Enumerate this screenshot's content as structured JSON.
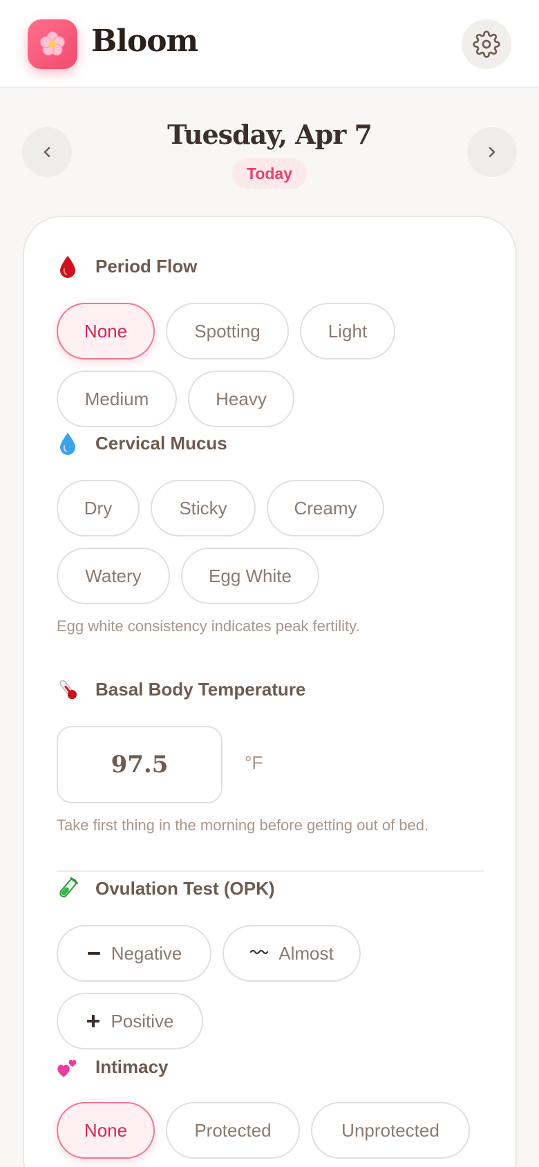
{
  "app": {
    "title": "Bloom",
    "logo_icon": "cherry-blossom-icon",
    "settings_icon": "gear-icon"
  },
  "date_nav": {
    "title": "Tuesday, Apr 7",
    "badge": "Today",
    "prev_icon": "chevron-left-icon",
    "next_icon": "chevron-right-icon"
  },
  "period_flow": {
    "title": "Period Flow",
    "icon": "blood-drop-icon",
    "options": [
      "None",
      "Spotting",
      "Light",
      "Medium",
      "Heavy"
    ],
    "selected": "None"
  },
  "cervical_mucus": {
    "title": "Cervical Mucus",
    "icon": "water-drop-icon",
    "options": [
      "Dry",
      "Sticky",
      "Creamy",
      "Watery",
      "Egg White"
    ],
    "selected": null,
    "hint": "Egg white consistency indicates peak fertility."
  },
  "bbt": {
    "title": "Basal Body Temperature",
    "icon": "thermometer-icon",
    "value": "97.5",
    "unit": "°F",
    "hint": "Take first thing in the morning before getting out of bed."
  },
  "opk": {
    "title": "Ovulation Test (OPK)",
    "icon": "test-tube-icon",
    "options": [
      {
        "label": "Negative",
        "icon": "minus-icon"
      },
      {
        "label": "Almost",
        "icon": "wave-icon"
      },
      {
        "label": "Positive",
        "icon": "plus-icon"
      }
    ],
    "selected": null
  },
  "intimacy": {
    "title": "Intimacy",
    "icon": "two-hearts-icon",
    "options": [
      "None",
      "Protected",
      "Unprotected"
    ],
    "selected": "None"
  },
  "colors": {
    "accent": "#f24a6e",
    "selected_text": "#d8254f",
    "selected_bg": "#fff0f3",
    "background": "#f8f7f5"
  }
}
